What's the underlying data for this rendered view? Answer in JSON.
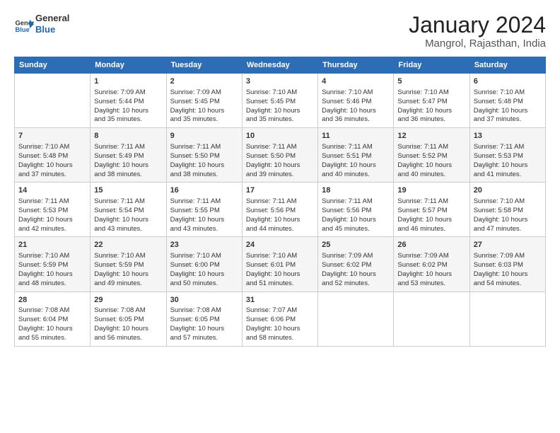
{
  "logo": {
    "line1": "General",
    "line2": "Blue",
    "icon": "▶"
  },
  "title": "January 2024",
  "subtitle": "Mangrol, Rajasthan, India",
  "days_header": [
    "Sunday",
    "Monday",
    "Tuesday",
    "Wednesday",
    "Thursday",
    "Friday",
    "Saturday"
  ],
  "weeks": [
    [
      {
        "day": "",
        "content": ""
      },
      {
        "day": "1",
        "content": "Sunrise: 7:09 AM\nSunset: 5:44 PM\nDaylight: 10 hours\nand 35 minutes."
      },
      {
        "day": "2",
        "content": "Sunrise: 7:09 AM\nSunset: 5:45 PM\nDaylight: 10 hours\nand 35 minutes."
      },
      {
        "day": "3",
        "content": "Sunrise: 7:10 AM\nSunset: 5:45 PM\nDaylight: 10 hours\nand 35 minutes."
      },
      {
        "day": "4",
        "content": "Sunrise: 7:10 AM\nSunset: 5:46 PM\nDaylight: 10 hours\nand 36 minutes."
      },
      {
        "day": "5",
        "content": "Sunrise: 7:10 AM\nSunset: 5:47 PM\nDaylight: 10 hours\nand 36 minutes."
      },
      {
        "day": "6",
        "content": "Sunrise: 7:10 AM\nSunset: 5:48 PM\nDaylight: 10 hours\nand 37 minutes."
      }
    ],
    [
      {
        "day": "7",
        "content": "Sunrise: 7:10 AM\nSunset: 5:48 PM\nDaylight: 10 hours\nand 37 minutes."
      },
      {
        "day": "8",
        "content": "Sunrise: 7:11 AM\nSunset: 5:49 PM\nDaylight: 10 hours\nand 38 minutes."
      },
      {
        "day": "9",
        "content": "Sunrise: 7:11 AM\nSunset: 5:50 PM\nDaylight: 10 hours\nand 38 minutes."
      },
      {
        "day": "10",
        "content": "Sunrise: 7:11 AM\nSunset: 5:50 PM\nDaylight: 10 hours\nand 39 minutes."
      },
      {
        "day": "11",
        "content": "Sunrise: 7:11 AM\nSunset: 5:51 PM\nDaylight: 10 hours\nand 40 minutes."
      },
      {
        "day": "12",
        "content": "Sunrise: 7:11 AM\nSunset: 5:52 PM\nDaylight: 10 hours\nand 40 minutes."
      },
      {
        "day": "13",
        "content": "Sunrise: 7:11 AM\nSunset: 5:53 PM\nDaylight: 10 hours\nand 41 minutes."
      }
    ],
    [
      {
        "day": "14",
        "content": "Sunrise: 7:11 AM\nSunset: 5:53 PM\nDaylight: 10 hours\nand 42 minutes."
      },
      {
        "day": "15",
        "content": "Sunrise: 7:11 AM\nSunset: 5:54 PM\nDaylight: 10 hours\nand 43 minutes."
      },
      {
        "day": "16",
        "content": "Sunrise: 7:11 AM\nSunset: 5:55 PM\nDaylight: 10 hours\nand 43 minutes."
      },
      {
        "day": "17",
        "content": "Sunrise: 7:11 AM\nSunset: 5:56 PM\nDaylight: 10 hours\nand 44 minutes."
      },
      {
        "day": "18",
        "content": "Sunrise: 7:11 AM\nSunset: 5:56 PM\nDaylight: 10 hours\nand 45 minutes."
      },
      {
        "day": "19",
        "content": "Sunrise: 7:11 AM\nSunset: 5:57 PM\nDaylight: 10 hours\nand 46 minutes."
      },
      {
        "day": "20",
        "content": "Sunrise: 7:10 AM\nSunset: 5:58 PM\nDaylight: 10 hours\nand 47 minutes."
      }
    ],
    [
      {
        "day": "21",
        "content": "Sunrise: 7:10 AM\nSunset: 5:59 PM\nDaylight: 10 hours\nand 48 minutes."
      },
      {
        "day": "22",
        "content": "Sunrise: 7:10 AM\nSunset: 5:59 PM\nDaylight: 10 hours\nand 49 minutes."
      },
      {
        "day": "23",
        "content": "Sunrise: 7:10 AM\nSunset: 6:00 PM\nDaylight: 10 hours\nand 50 minutes."
      },
      {
        "day": "24",
        "content": "Sunrise: 7:10 AM\nSunset: 6:01 PM\nDaylight: 10 hours\nand 51 minutes."
      },
      {
        "day": "25",
        "content": "Sunrise: 7:09 AM\nSunset: 6:02 PM\nDaylight: 10 hours\nand 52 minutes."
      },
      {
        "day": "26",
        "content": "Sunrise: 7:09 AM\nSunset: 6:02 PM\nDaylight: 10 hours\nand 53 minutes."
      },
      {
        "day": "27",
        "content": "Sunrise: 7:09 AM\nSunset: 6:03 PM\nDaylight: 10 hours\nand 54 minutes."
      }
    ],
    [
      {
        "day": "28",
        "content": "Sunrise: 7:08 AM\nSunset: 6:04 PM\nDaylight: 10 hours\nand 55 minutes."
      },
      {
        "day": "29",
        "content": "Sunrise: 7:08 AM\nSunset: 6:05 PM\nDaylight: 10 hours\nand 56 minutes."
      },
      {
        "day": "30",
        "content": "Sunrise: 7:08 AM\nSunset: 6:05 PM\nDaylight: 10 hours\nand 57 minutes."
      },
      {
        "day": "31",
        "content": "Sunrise: 7:07 AM\nSunset: 6:06 PM\nDaylight: 10 hours\nand 58 minutes."
      },
      {
        "day": "",
        "content": ""
      },
      {
        "day": "",
        "content": ""
      },
      {
        "day": "",
        "content": ""
      }
    ]
  ]
}
